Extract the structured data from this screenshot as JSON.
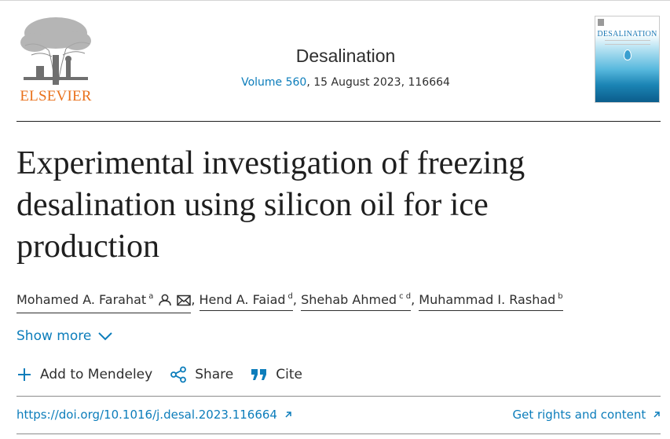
{
  "header": {
    "publisher": "ELSEVIER",
    "journal_title": "Desalination",
    "volume_link": "Volume 560",
    "issue_info": ", 15 August 2023, 116664",
    "cover_title": "DESALINATION"
  },
  "article": {
    "title": "Experimental investigation of freezing desalination using silicon oil for ice production"
  },
  "authors": [
    {
      "name": "Mohamed A. Farahat",
      "affiliations": "a"
    },
    {
      "name": "Hend A. Faiad",
      "affiliations": "d"
    },
    {
      "name": "Shehab Ahmed",
      "affiliations": "c d"
    },
    {
      "name": "Muhammad I. Rashad",
      "affiliations": "b"
    }
  ],
  "show_more": {
    "label": "Show more"
  },
  "actions": {
    "mendeley": "Add to Mendeley",
    "share": "Share",
    "cite": "Cite"
  },
  "links": {
    "doi": "https://doi.org/10.1016/j.desal.2023.116664",
    "rights": "Get rights and content"
  },
  "icons": {
    "person": "person-icon",
    "mail": "mail-icon",
    "chevron": "chevron-down-icon",
    "plus": "plus-icon",
    "share": "share-icon",
    "quote": "quote-icon",
    "external": "external-link-icon"
  },
  "colors": {
    "link_blue": "#0c7dbb",
    "elsevier_orange": "#e9711c",
    "text": "#2e2e2e"
  }
}
